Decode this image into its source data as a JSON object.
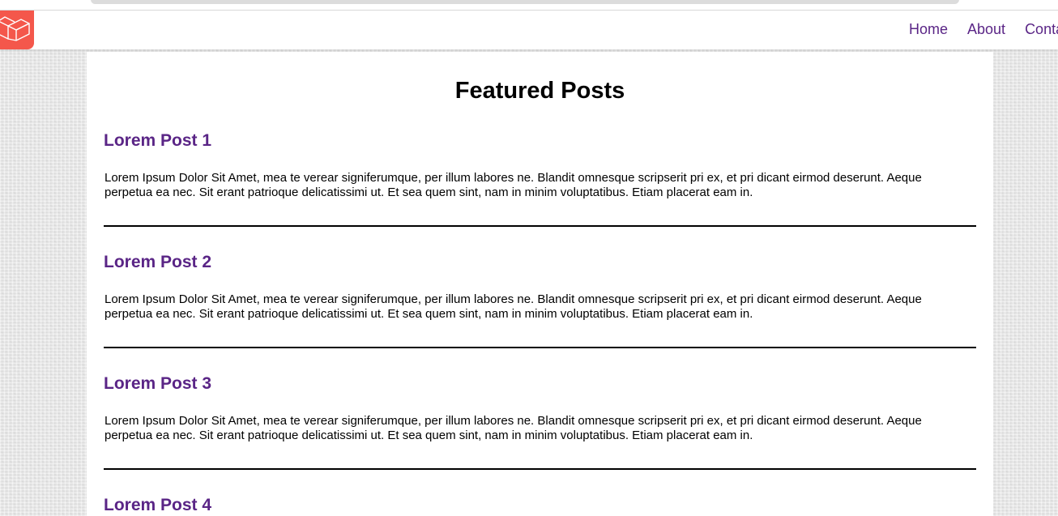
{
  "navbar": {
    "brand_icon": "laravel-logo-icon",
    "links": [
      {
        "label": "Home"
      },
      {
        "label": "About"
      },
      {
        "label": "Conta"
      }
    ]
  },
  "main": {
    "title": "Featured Posts",
    "posts": [
      {
        "title": "Lorem Post 1",
        "body": "Lorem Ipsum Dolor Sit Amet, mea te verear signiferumque, per illum labores ne. Blandit omnesque scripserit pri ex, et pri dicant eirmod deserunt. Aeque perpetua ea nec. Sit erant patrioque delicatissimi ut. Et sea quem sint, nam in minim voluptatibus. Etiam placerat eam in."
      },
      {
        "title": "Lorem Post 2",
        "body": "Lorem Ipsum Dolor Sit Amet, mea te verear signiferumque, per illum labores ne. Blandit omnesque scripserit pri ex, et pri dicant eirmod deserunt. Aeque perpetua ea nec. Sit erant patrioque delicatissimi ut. Et sea quem sint, nam in minim voluptatibus. Etiam placerat eam in."
      },
      {
        "title": "Lorem Post 3",
        "body": "Lorem Ipsum Dolor Sit Amet, mea te verear signiferumque, per illum labores ne. Blandit omnesque scripserit pri ex, et pri dicant eirmod deserunt. Aeque perpetua ea nec. Sit erant patrioque delicatissimi ut. Et sea quem sint, nam in minim voluptatibus. Etiam placerat eam in."
      },
      {
        "title": "Lorem Post 4",
        "body": ""
      }
    ]
  },
  "colors": {
    "accent": "#5a2586",
    "brand": "#f4574b"
  }
}
